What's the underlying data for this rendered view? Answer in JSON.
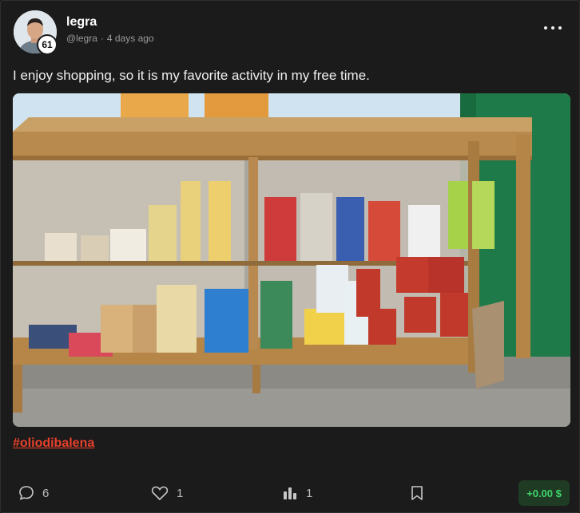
{
  "post": {
    "author": {
      "name": "legra",
      "handle": "@legra",
      "level": "61"
    },
    "time_ago": "4 days ago",
    "text": "I enjoy shopping, so it is my favorite activity in my free time.",
    "hashtag": "#oliodibalena",
    "image": {
      "description_icon": "photo-of-glass-display-case-with-groceries"
    }
  },
  "actions": {
    "comments": "6",
    "likes": "1",
    "views": "1",
    "tip": "+0.00 $"
  },
  "colors": {
    "background": "#1b1b1b",
    "hashtag": "#e8412b",
    "tip_bg": "#1f3b24",
    "tip_text": "#3fd46a"
  }
}
